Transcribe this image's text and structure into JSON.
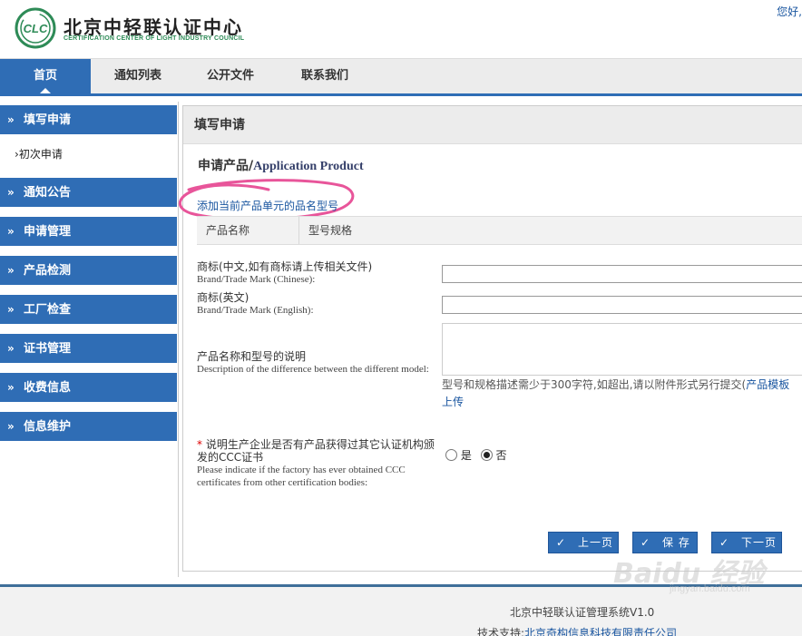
{
  "header": {
    "logo_mark": "CLC",
    "logo_cn": "北京中轻联认证中心",
    "logo_en": "CERTIFICATION CENTER OF LIGHT INDUSTRY COUNCIL",
    "greeting": "您好,"
  },
  "nav": {
    "items": [
      {
        "label": "首页",
        "active": true
      },
      {
        "label": "通知列表"
      },
      {
        "label": "公开文件"
      },
      {
        "label": "联系我们"
      }
    ]
  },
  "sidebar": {
    "chevron": "»",
    "sub_marker": "›",
    "sections": [
      {
        "label": "填写申请",
        "children": [
          "初次申请"
        ]
      },
      {
        "label": "通知公告"
      },
      {
        "label": "申请管理"
      },
      {
        "label": "产品检测"
      },
      {
        "label": "工厂检查"
      },
      {
        "label": "证书管理"
      },
      {
        "label": "收费信息"
      },
      {
        "label": "信息维护"
      }
    ]
  },
  "panel": {
    "title": "填写申请",
    "section_title_cn": "申请产品/",
    "section_title_en": "Application Product",
    "add_link": "添加当前产品单元的品名型号",
    "table_headers": [
      "产品名称",
      "型号规格"
    ],
    "fields": {
      "brand_cn_label": "商标(中文,如有商标请上传相关文件)",
      "brand_cn_label_en": "Brand/Trade Mark (Chinese):",
      "brand_en_label": "商标(英文)",
      "brand_en_label_en": "Brand/Trade Mark (English):",
      "desc_label": "产品名称和型号的说明",
      "desc_label_en": "Description of the difference between the different model:",
      "desc_hint": "型号和规格描述需少于300字符,如超出,请以附件形式另行提交(",
      "desc_hint_link": "产品模板",
      "upload_link": "上传",
      "question_star": "*",
      "question_cn": "说明生产企业是否有产品获得过其它认证机构颁发的CCC证书",
      "question_en": "Please indicate if the factory has ever obtained CCC certificates from other certification bodies:",
      "radio_yes": "是",
      "radio_no": "否",
      "selected": "否"
    },
    "buttons": {
      "check": "✓",
      "prev": "上一页",
      "save": "保 存",
      "next": "下一页"
    }
  },
  "footer": {
    "system": "北京中轻联认证管理系统V1.0",
    "support_label": "技术支持:",
    "support_company": "北京奇构信息科技有限责任公司"
  },
  "watermark": {
    "text": "Baidu 经验",
    "url": "jingyan.baidu.com"
  },
  "colors": {
    "primary": "#2f6db5",
    "link": "#1a56a0",
    "annotation": "#e8559a",
    "logo_green": "#2e8b57"
  }
}
